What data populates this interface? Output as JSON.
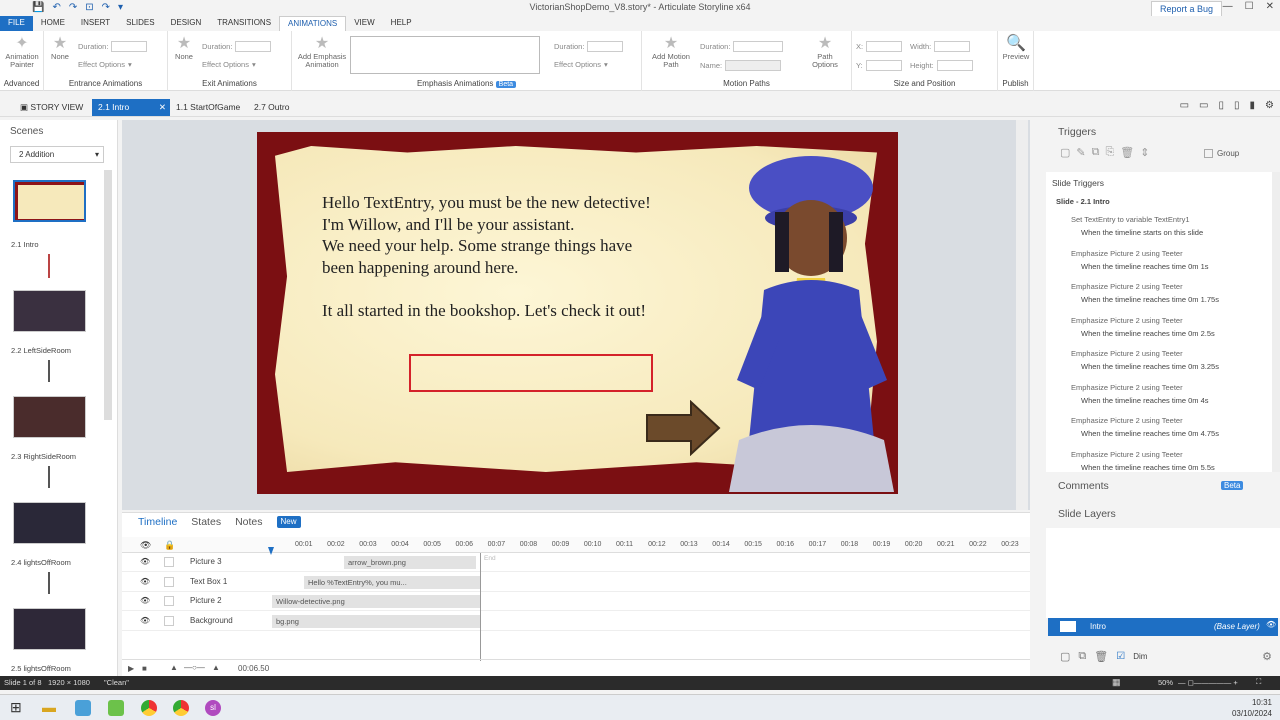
{
  "window": {
    "title": "VictorianShopDemo_V8.story* - Articulate Storyline x64",
    "report_bug": "Report a Bug"
  },
  "tabs": [
    "FILE",
    "HOME",
    "INSERT",
    "SLIDES",
    "DESIGN",
    "TRANSITIONS",
    "ANIMATIONS",
    "VIEW",
    "HELP"
  ],
  "ribbon": {
    "advanced": {
      "button": "Animation\nPainter",
      "label": "Advanced"
    },
    "entrance": {
      "none": "None",
      "duration": "Duration:",
      "effect": "Effect Options",
      "label": "Entrance Animations"
    },
    "exit": {
      "none": "None",
      "duration": "Duration:",
      "effect": "Effect Options",
      "label": "Exit Animations"
    },
    "emphasis": {
      "add": "Add Emphasis\nAnimation",
      "duration": "Duration:",
      "effect": "Effect Options",
      "label": "Emphasis Animations",
      "beta": "Beta"
    },
    "motion": {
      "add": "Add Motion\nPath",
      "duration": "Duration:",
      "name": "Name:",
      "path_options": "Path\nOptions",
      "label": "Motion Paths"
    },
    "size": {
      "x": "X:",
      "y": "Y:",
      "width": "Width:",
      "height": "Height:",
      "label": "Size and Position"
    },
    "publish": {
      "preview": "Preview",
      "label": "Publish"
    }
  },
  "doc_tabs": [
    "STORY VIEW",
    "2.1 Intro",
    "1.1 StartOfGame",
    "2.7 Outro"
  ],
  "scenes": {
    "title": "Scenes",
    "dropdown": "2 Addition",
    "items": [
      "2.1 Intro",
      "2.2 LeftSideRoom",
      "2.3 RightSideRoom",
      "2.4 lightsOffRoom",
      "2.5 lightsOffRoom"
    ]
  },
  "slide": {
    "text": "Hello TextEntry, you must be the new detective!\nI'm Willow, and I'll be your assistant.\nWe need your help. Some strange things have\nbeen happening around here.\n\nIt all started in the bookshop. Let's check it out!"
  },
  "triggers": {
    "title": "Triggers",
    "group": "Group",
    "slide_triggers": "Slide Triggers",
    "slide_name": "Slide - 2.1 Intro",
    "items": [
      {
        "action": "Set TextEntry to variable TextEntry1",
        "when": "When the timeline starts on this slide"
      },
      {
        "action": "Emphasize Picture 2 using Teeter",
        "when": "When the timeline reaches time 0m 1s"
      },
      {
        "action": "Emphasize Picture 2 using Teeter",
        "when": "When the timeline reaches time 0m 1.75s"
      },
      {
        "action": "Emphasize Picture 2 using Teeter",
        "when": "When the timeline reaches time 0m 2.5s"
      },
      {
        "action": "Emphasize Picture 2 using Teeter",
        "when": "When the timeline reaches time 0m 3.25s"
      },
      {
        "action": "Emphasize Picture 2 using Teeter",
        "when": "When the timeline reaches time 0m 4s"
      },
      {
        "action": "Emphasize Picture 2 using Teeter",
        "when": "When the timeline reaches time 0m 4.75s"
      },
      {
        "action": "Emphasize Picture 2 using Teeter",
        "when": "When the timeline reaches time 0m 5.5s"
      }
    ],
    "comments": "Comments",
    "comments_beta": "Beta",
    "slide_layers": "Slide Layers",
    "layer_name": "Intro",
    "layer_tag": "(Base Layer)",
    "dim": "Dim"
  },
  "timeline": {
    "tabs": [
      "Timeline",
      "States",
      "Notes"
    ],
    "new_badge": "New",
    "ticks": [
      "00:01",
      "00:02",
      "00:03",
      "00:04",
      "00:05",
      "00:06",
      "00:07",
      "00:08",
      "00:09",
      "00:10",
      "00:11",
      "00:12",
      "00:13",
      "00:14",
      "00:15",
      "00:16",
      "00:17",
      "00:18",
      "00:19",
      "00:20",
      "00:21",
      "00:22",
      "00:23"
    ],
    "end": "End",
    "rows": [
      {
        "name": "Picture 3",
        "bar": "arrow_brown.png"
      },
      {
        "name": "Text Box 1",
        "bar": "Hello %TextEntry%, you mu..."
      },
      {
        "name": "Picture 2",
        "bar": "Willow-detective.png"
      },
      {
        "name": "Background",
        "bar": "bg.png"
      }
    ],
    "time": "00:06.50"
  },
  "status": {
    "slide": "Slide 1 of 8",
    "size": "1920 × 1080",
    "theme": "\"Clean\"",
    "zoom": "50%"
  },
  "taskbar": {
    "time": "10:31",
    "date": "03/10/2024"
  }
}
